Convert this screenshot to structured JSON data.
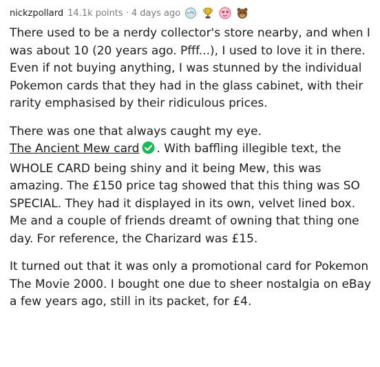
{
  "comment": {
    "username": "nickzpollard",
    "points": "14.1k points",
    "separator": "·",
    "age": "4 days ago",
    "awards": [
      {
        "icon": "glass-orb-award-icon"
      },
      {
        "icon": "gold-trophy-award-icon"
      },
      {
        "icon": "heart-eyes-award-icon"
      },
      {
        "icon": "brown-bear-award-icon"
      }
    ],
    "paragraphs": {
      "p1": "There used to be a nerdy collector's store nearby, and when I was about 10 (20 years ago. Pfff...), I used to love it in there. Even if not buying anything, I was stunned by the individual Pokemon cards that they had in the glass cabinet, with their rarity emphasised by their ridiculous prices.",
      "p2_intro": "There was one that always caught my eye.",
      "p2_link": "The Ancient Mew card",
      "p2_rest": ". With baffling illegible text, the WHOLE CARD being shiny and it being Mew, this was amazing. The £150 price tag showed that this thing was SO SPECIAL. They had it displayed in its own, velvet lined box. Me and a couple of friends dreamt of owning that thing one day. For reference, the Charizard was £15.",
      "p3": "It turned out that it was only a promotional card for Pokemon The Movie 2000. I bought one due to sheer nostalgia on eBay a few years ago, still in its packet, for £4."
    }
  },
  "colors": {
    "meta_text": "#787c7e",
    "body_text": "#1c1c1c",
    "verified_green": "#1db954"
  }
}
